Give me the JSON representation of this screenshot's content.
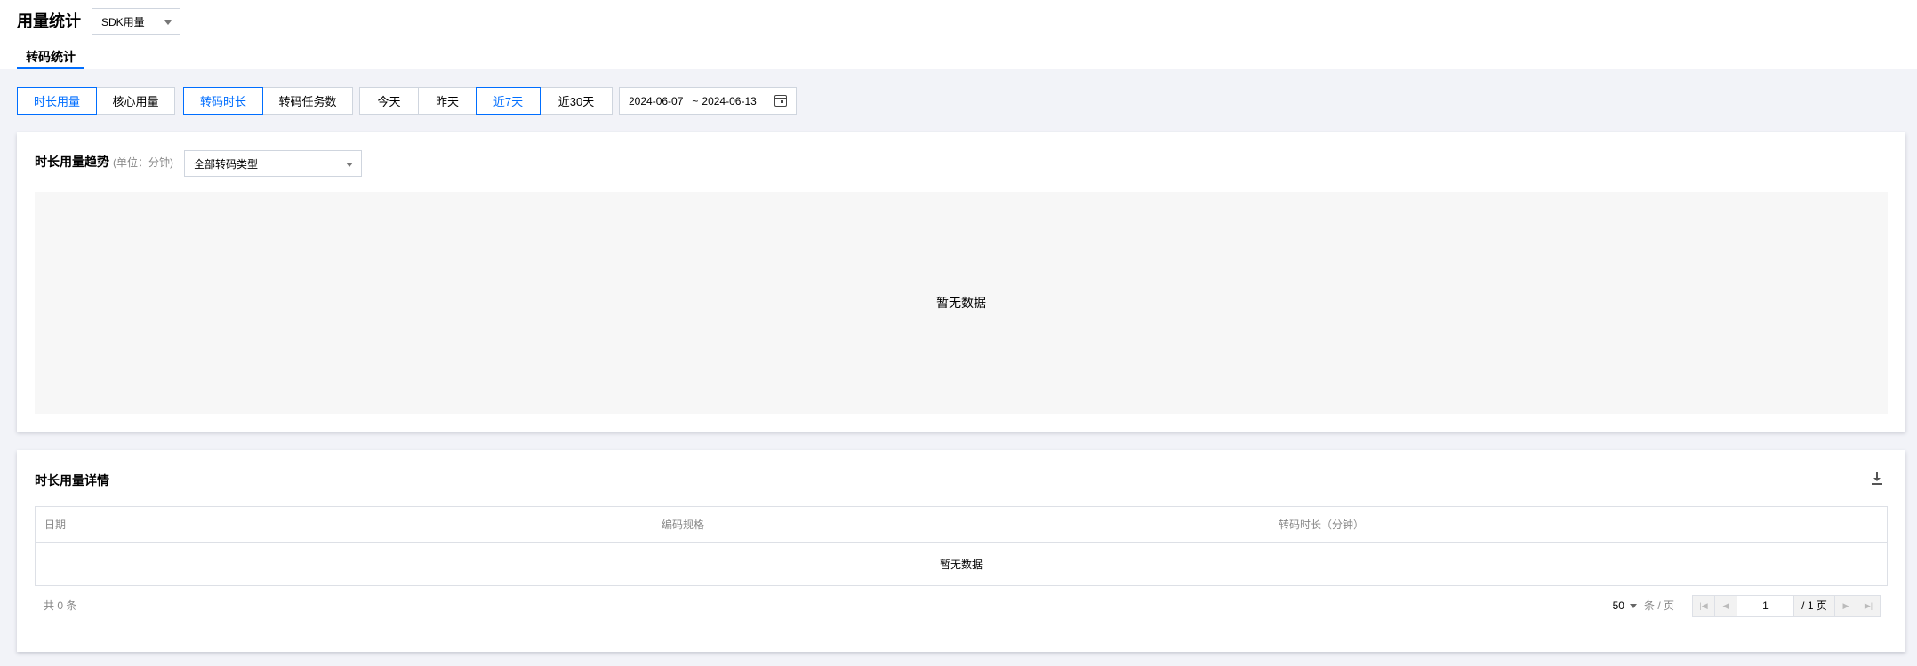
{
  "header": {
    "title": "用量统计",
    "product_select": "SDK用量",
    "tab": "转码统计"
  },
  "filters": {
    "usage_group": [
      "时长用量",
      "核心用量"
    ],
    "usage_active": "时长用量",
    "metric_group": [
      "转码时长",
      "转码任务数"
    ],
    "metric_active": "转码时长",
    "range_group": [
      "今天",
      "昨天",
      "近7天",
      "近30天"
    ],
    "range_active": "近7天",
    "date_start": "2024-06-07",
    "date_sep": "~",
    "date_end": "2024-06-13"
  },
  "trend": {
    "title": "时长用量趋势",
    "unit": "(单位：分钟)",
    "type_select": "全部转码类型",
    "empty_text": "暂无数据"
  },
  "detail": {
    "title": "时长用量详情",
    "columns": [
      "日期",
      "编码规格",
      "转码时长（分钟）"
    ],
    "empty_text": "暂无数据",
    "total_text": "共  0  条",
    "page_size": "50",
    "page_size_unit": "条 / 页",
    "current_page": "1",
    "page_total": "/ 1 页"
  }
}
